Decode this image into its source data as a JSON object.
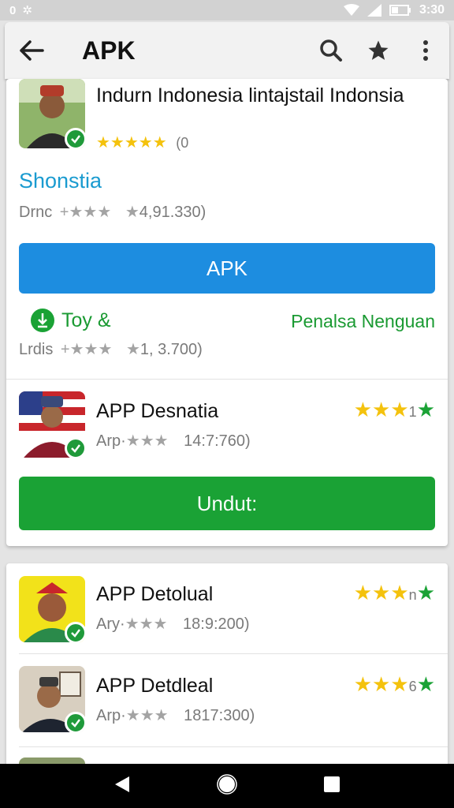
{
  "status_bar": {
    "left_text": "0",
    "time": "3:30"
  },
  "toolbar": {
    "title": "APK"
  },
  "featured": {
    "name": "Indurn Indonesia lintajstail Indonsia",
    "rating_stars": "★★★★★",
    "rating_count": "(0",
    "section_title": "Shonstia",
    "meta1_label": "Drnc",
    "meta1_value": "4,91.330)",
    "apk_button": "APK",
    "toy_label": "Toy &",
    "right_label": "Penalsa Nenguan",
    "meta2_label": "Lrdis",
    "meta2_value": "1, 3.700)"
  },
  "apps": [
    {
      "name": "APP Desnatia",
      "meta_label": "Arp·",
      "meta_value": "14:7:760)",
      "rating_suffix": "1",
      "button": "Undut:"
    },
    {
      "name": "APP Detolual",
      "meta_label": "Ary·",
      "meta_value": "18:9:200)",
      "rating_suffix": "n"
    },
    {
      "name": "APP Detdleal",
      "meta_label": "Arp·",
      "meta_value": "1817:300)",
      "rating_suffix": "6"
    }
  ],
  "icons": [
    "back-arrow-icon",
    "search-icon",
    "star-icon",
    "more-vert-icon",
    "verified-check-icon",
    "nav-back-icon",
    "nav-home-icon",
    "nav-recents-icon"
  ],
  "colors": {
    "accent_blue": "#1d8de0",
    "accent_green": "#1aa235",
    "star_yellow": "#f4c20d",
    "teal_text": "#1a9bd0"
  }
}
